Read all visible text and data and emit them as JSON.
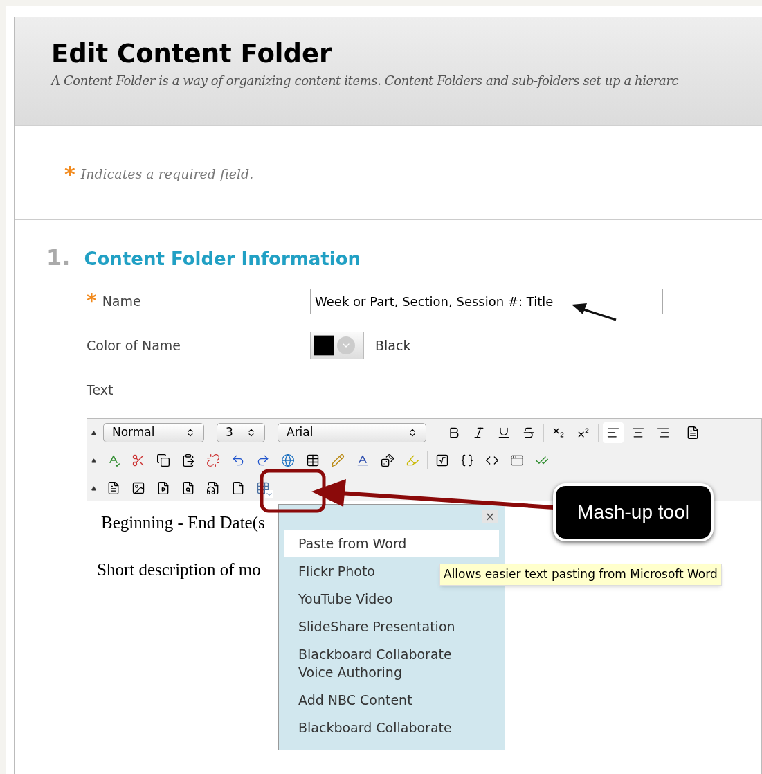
{
  "page": {
    "title": "Edit Content Folder",
    "description": "A Content Folder is a way of organizing content items. Content Folders and sub-folders set up a hierarc"
  },
  "required_note": {
    "mark": "*",
    "text": "Indicates a required field."
  },
  "section": {
    "number": "1.",
    "title": "Content Folder Information"
  },
  "fields": [
    {
      "kind": "text",
      "label": "Name",
      "required": true,
      "value": "Week or Part, Section, Session #: Title"
    },
    {
      "kind": "color",
      "label": "Color of Name",
      "required": false,
      "value": "Black",
      "color": "#000000"
    },
    {
      "kind": "label",
      "label": "Text",
      "required": false
    }
  ],
  "editor": {
    "selects": [
      {
        "kind": "wide",
        "value": "Normal"
      },
      {
        "kind": "narrow",
        "value": "3"
      },
      {
        "kind": "xwide",
        "value": "Arial"
      }
    ],
    "align_buttons": [
      {
        "kind": "left",
        "selected": true
      },
      {
        "kind": "center",
        "selected": false
      },
      {
        "kind": "right",
        "selected": false
      }
    ],
    "body": [
      "Beginning - End Date(s",
      "Short description of mo"
    ]
  },
  "mashup_menu": {
    "close": "×",
    "items": [
      {
        "label": "Paste from Word",
        "selected": true
      },
      {
        "label": "Flickr Photo",
        "selected": false
      },
      {
        "label": "YouTube Video",
        "selected": false
      },
      {
        "label": "SlideShare Presentation",
        "selected": false
      },
      {
        "label": "Blackboard Collaborate Voice Authoring",
        "selected": false
      },
      {
        "label": "Add NBC Content",
        "selected": false
      },
      {
        "label": "Blackboard Collaborate",
        "selected": false
      }
    ]
  },
  "tooltip": "Allows easier text pasting from Microsoft Word",
  "callout": "Mash-up tool"
}
